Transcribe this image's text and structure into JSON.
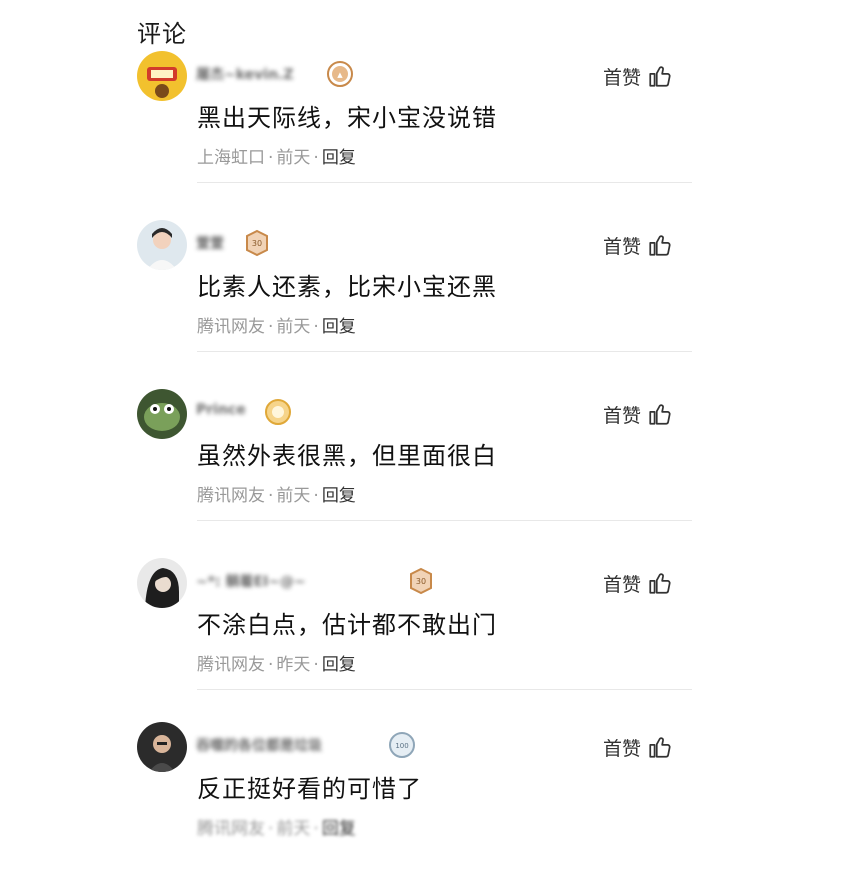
{
  "section_title": "评论",
  "like_label": "首赞",
  "reply_label": "回复",
  "icons": {
    "like": "thumbs-up-icon",
    "badge": "rank-badge-icon"
  },
  "comments": [
    {
      "username": "屠杰~kevin.Z",
      "avatar_color": "#f2c12e",
      "badge_color": "#c8894a",
      "text": "黑出天际线，宋小宝没说错",
      "location": "上海虹口",
      "time": "前天"
    },
    {
      "username": "萱萱",
      "avatar_color": "#dfe8ee",
      "badge_color": "#c8894a",
      "text": "比素人还素，比宋小宝还黑",
      "location": "腾讯网友",
      "time": "前天"
    },
    {
      "username": "Prince",
      "avatar_color": "#4f6b3d",
      "badge_color": "#e0a838",
      "text": "虽然外表很黑，但里面很白",
      "location": "腾讯网友",
      "time": "前天"
    },
    {
      "username": "~*: 躺着EI~@~",
      "avatar_color": "#3a3a3a",
      "badge_color": "#c8894a",
      "text": "不涂白点，估计都不敢出门",
      "location": "腾讯网友",
      "time": "昨天"
    },
    {
      "username": "吞噬的各位都是垃圾",
      "avatar_color": "#2b2b2b",
      "badge_color": "#8fa6b8",
      "text": "反正挺好看的可惜了",
      "location": "腾讯网友",
      "time": "前天"
    }
  ]
}
